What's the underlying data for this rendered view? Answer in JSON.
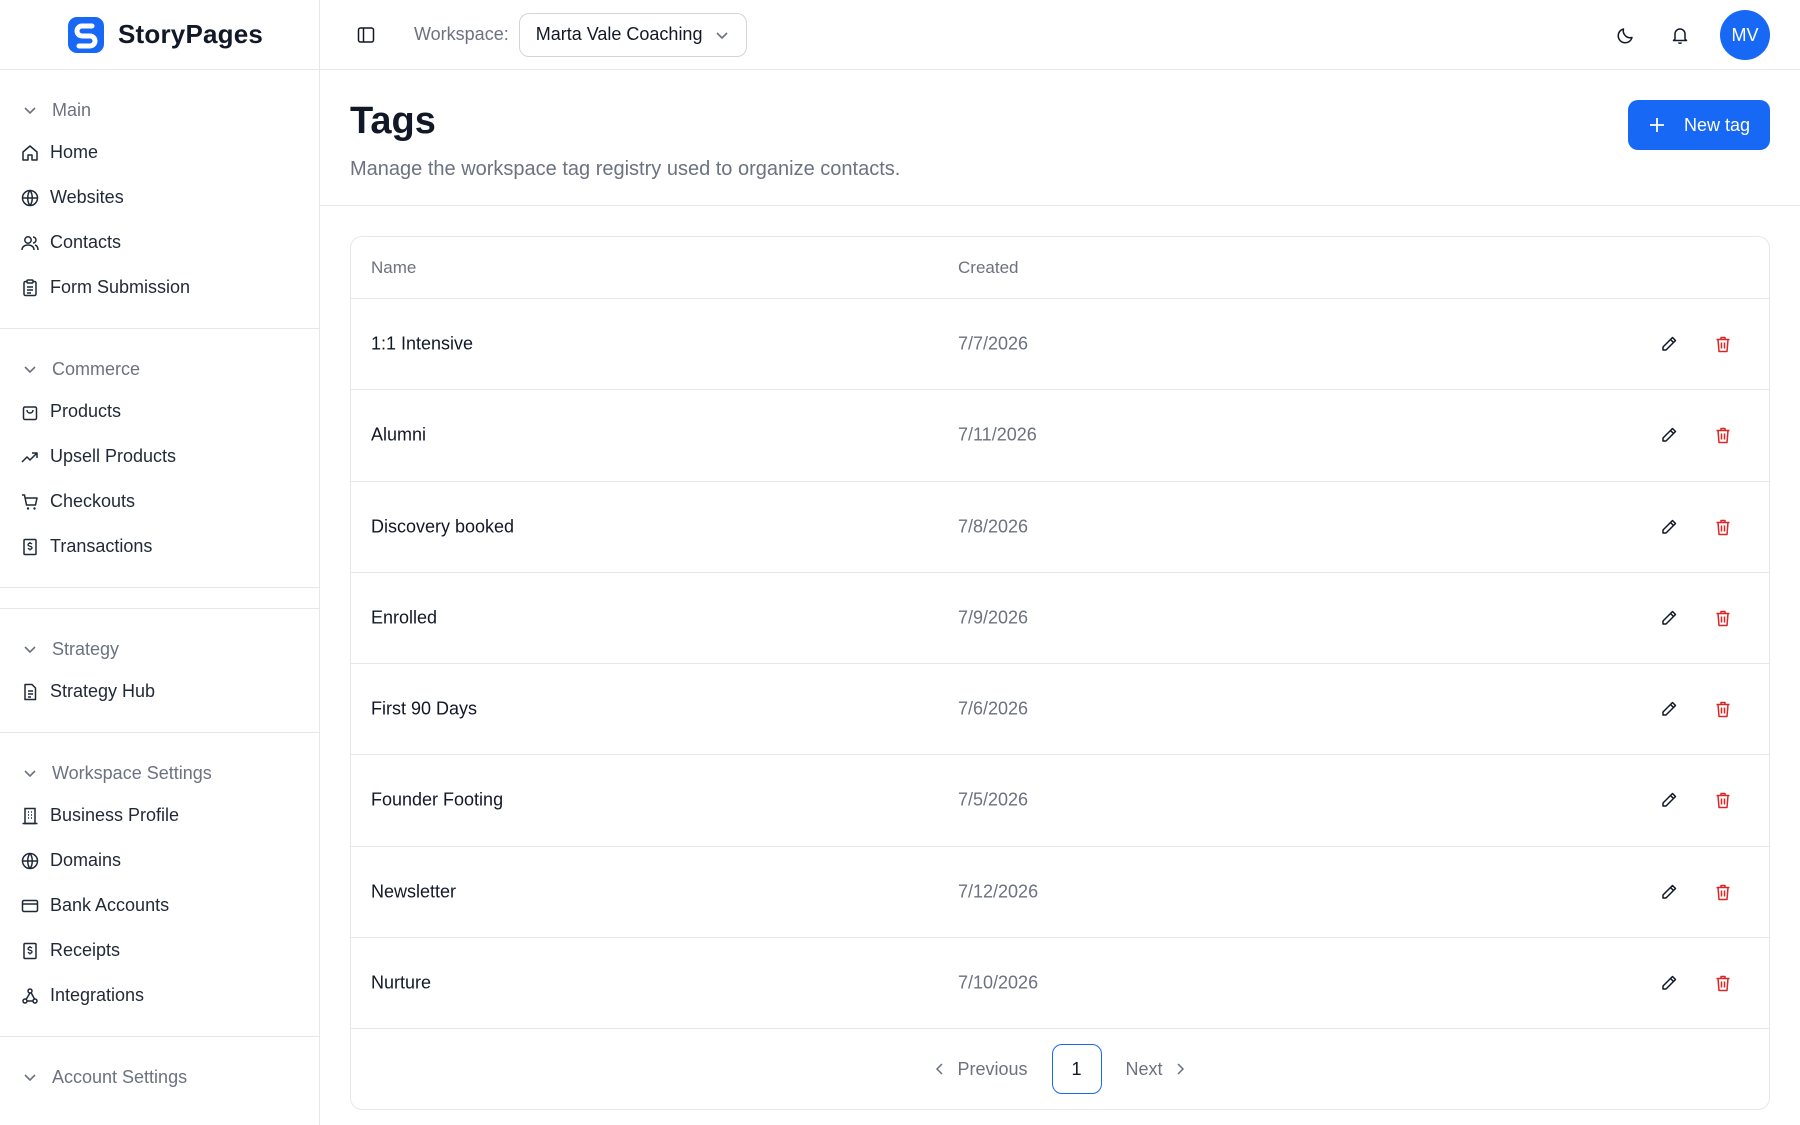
{
  "brand": {
    "name": "StoryPages",
    "accent": "#1769f5"
  },
  "sidebar": {
    "groups": [
      {
        "title": "Main",
        "items": [
          {
            "label": "Home",
            "icon": "home-icon"
          },
          {
            "label": "Websites",
            "icon": "globe-icon"
          },
          {
            "label": "Contacts",
            "icon": "users-icon"
          },
          {
            "label": "Form Submission",
            "icon": "clipboard-icon"
          }
        ]
      },
      {
        "title": "Commerce",
        "items": [
          {
            "label": "Products",
            "icon": "shopping-bag-icon"
          },
          {
            "label": "Upsell Products",
            "icon": "trending-up-icon"
          },
          {
            "label": "Checkouts",
            "icon": "cart-icon"
          },
          {
            "label": "Transactions",
            "icon": "receipt-icon"
          }
        ]
      },
      {
        "title": "Strategy",
        "items": [
          {
            "label": "Strategy Hub",
            "icon": "document-icon"
          }
        ]
      },
      {
        "title": "Workspace Settings",
        "items": [
          {
            "label": "Business Profile",
            "icon": "building-icon"
          },
          {
            "label": "Domains",
            "icon": "globe-icon"
          },
          {
            "label": "Bank Accounts",
            "icon": "credit-card-icon"
          },
          {
            "label": "Receipts",
            "icon": "receipt-icon"
          },
          {
            "label": "Integrations",
            "icon": "webhook-icon"
          }
        ]
      },
      {
        "title": "Account Settings",
        "items": []
      }
    ]
  },
  "topbar": {
    "workspace_label": "Workspace:",
    "workspace_value": "Marta Vale Coaching",
    "avatar_initials": "MV"
  },
  "page": {
    "title": "Tags",
    "subtitle": "Manage the workspace tag registry used to organize contacts.",
    "new_button": "New tag"
  },
  "table": {
    "columns": [
      "Name",
      "Created"
    ],
    "rows": [
      {
        "name": "1:1 Intensive",
        "created": "7/7/2026"
      },
      {
        "name": "Alumni",
        "created": "7/11/2026"
      },
      {
        "name": "Discovery booked",
        "created": "7/8/2026"
      },
      {
        "name": "Enrolled",
        "created": "7/9/2026"
      },
      {
        "name": "First 90 Days",
        "created": "7/6/2026"
      },
      {
        "name": "Founder Footing",
        "created": "7/5/2026"
      },
      {
        "name": "Newsletter",
        "created": "7/12/2026"
      },
      {
        "name": "Nurture",
        "created": "7/10/2026"
      }
    ]
  },
  "pagination": {
    "previous": "Previous",
    "current": "1",
    "next": "Next"
  }
}
